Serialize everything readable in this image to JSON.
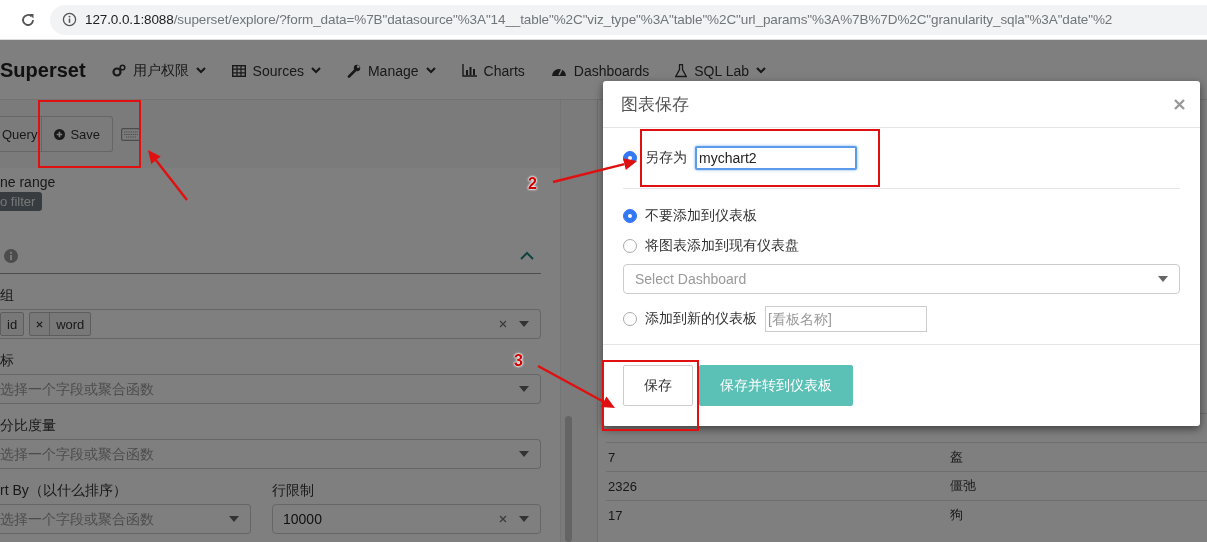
{
  "browser": {
    "url": "127.0.0.1:8088/superset/explore/?form_data=%7B\"datasource\"%3A\"14__table\"%2C\"viz_type\"%3A\"table\"%2C\"url_params\"%3A%7B%7D%2C\"granularity_sqla\"%3A\"date\"%2"
  },
  "navbar": {
    "brand": "Superset",
    "items": [
      {
        "label": "用户权限",
        "dropdown": true
      },
      {
        "label": "Sources",
        "dropdown": true
      },
      {
        "label": "Manage",
        "dropdown": true
      },
      {
        "label": "Charts",
        "dropdown": false
      },
      {
        "label": "Dashboards",
        "dropdown": false
      },
      {
        "label": "SQL Lab",
        "dropdown": true
      }
    ]
  },
  "toolbar": {
    "buttons": [
      {
        "label": "Query",
        "icon": false
      },
      {
        "label": "Save",
        "icon": true
      }
    ]
  },
  "controls": {
    "time_range": {
      "label": "ne range",
      "value": "o filter"
    },
    "section": {
      "expanded": true
    },
    "rows": [
      [
        {
          "label": "组",
          "kind": "multi",
          "tags": [
            {
              "label": "id",
              "removable": false
            },
            {
              "label": "word",
              "removable": true
            }
          ],
          "clearable": true
        }
      ],
      [
        {
          "label": "标",
          "kind": "select",
          "placeholder": "选择一个字段或聚合函数",
          "clearable": false
        }
      ],
      [
        {
          "label": "分比度量",
          "kind": "select",
          "placeholder": "选择一个字段或聚合函数",
          "clearable": false
        }
      ],
      [
        {
          "label": "rt By（以什么排序）",
          "kind": "select",
          "placeholder": "选择一个字段或聚合函数",
          "clearable": false
        },
        {
          "label": "行限制",
          "kind": "select",
          "value": "10000",
          "clearable": true
        }
      ]
    ]
  },
  "table": {
    "rows": [
      [
        "7",
        "盔"
      ],
      [
        "2326",
        "僵弛"
      ],
      [
        "17",
        "狗"
      ]
    ]
  },
  "modal": {
    "title": "图表保存",
    "save_as": {
      "label": "另存为",
      "value": "mychart2",
      "selected": true
    },
    "dashboard_options": [
      {
        "label": "不要添加到仪表板",
        "selected": true
      },
      {
        "label": "将图表添加到现有仪表盘",
        "selected": false,
        "select": {
          "placeholder": "Select Dashboard"
        }
      },
      {
        "label": "添加到新的仪表板",
        "selected": false,
        "input": {
          "placeholder": "[看板名称]"
        }
      }
    ],
    "buttons": [
      {
        "label": "保存",
        "kind": "default"
      },
      {
        "label": "保存并转到仪表板",
        "kind": "primary"
      }
    ]
  },
  "annotations": [
    {
      "label": "2"
    },
    {
      "label": "3"
    }
  ]
}
